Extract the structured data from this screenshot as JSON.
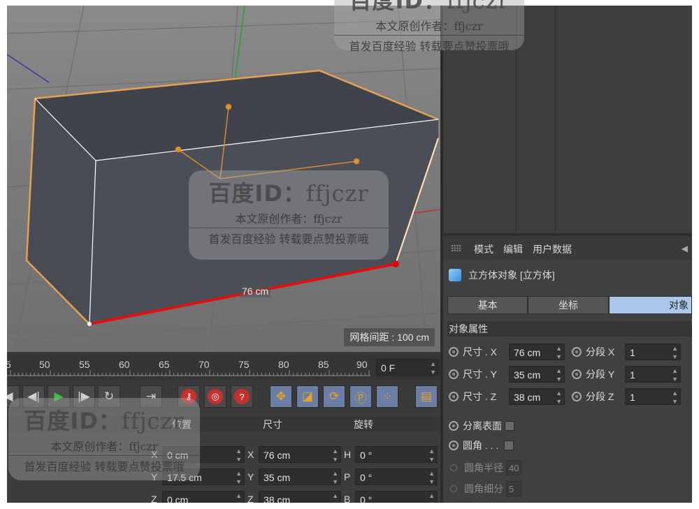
{
  "viewport": {
    "grid_spacing_label": "网格间距 : 100 cm",
    "dimension_label": "76 cm"
  },
  "attributes": {
    "menu": [
      "模式",
      "编辑",
      "用户数据"
    ],
    "object_title": "立方体对象 [立方体]",
    "tabs": [
      "基本",
      "坐标",
      "对象"
    ],
    "active_tab": "对象",
    "section": "对象属性",
    "size_rows": [
      {
        "label": "尺寸 . X",
        "value": "76 cm",
        "seg_label": "分段 X",
        "seg_value": "1"
      },
      {
        "label": "尺寸 . Y",
        "value": "35 cm",
        "seg_label": "分段 Y",
        "seg_value": "1"
      },
      {
        "label": "尺寸 . Z",
        "value": "38 cm",
        "seg_label": "分段 Z",
        "seg_value": "1"
      }
    ],
    "separate_surfaces": "分离表面",
    "fillet": "圆角 . . .",
    "fillet_radius": {
      "label": "圆角半径",
      "value": "40"
    },
    "fillet_subdivision": {
      "label": "圆角细分",
      "value": "5"
    }
  },
  "timeline": {
    "ticks": [
      "5",
      "50",
      "55",
      "60",
      "65",
      "70",
      "75",
      "80",
      "85",
      "90"
    ],
    "current_frame": "0 F"
  },
  "coordinates": {
    "headers": [
      "位置",
      "尺寸",
      "旋转"
    ],
    "rows": [
      {
        "axis": "X",
        "pos": "0 cm",
        "size_axis": "X",
        "size": "76 cm",
        "rot_axis": "H",
        "rot": "0 °"
      },
      {
        "axis": "Y",
        "pos": "17.5 cm",
        "size_axis": "Y",
        "size": "35 cm",
        "rot_axis": "P",
        "rot": "0 °"
      },
      {
        "axis": "Z",
        "pos": "0 cm",
        "size_axis": "Z",
        "size": "38 cm",
        "rot_axis": "B",
        "rot": "0 °"
      }
    ]
  },
  "watermark": {
    "title_cn": "百度ID：",
    "title_id": "ffjczr",
    "line1": "本文原创作者：ffjczr",
    "line2": "首发百度经验 转载要点赞投票哦"
  },
  "colors": {
    "selection_edge": "#e8a050",
    "measure_edge": "#e01010",
    "active_tab": "#a9c8ec",
    "record_button": "#c9302c"
  }
}
